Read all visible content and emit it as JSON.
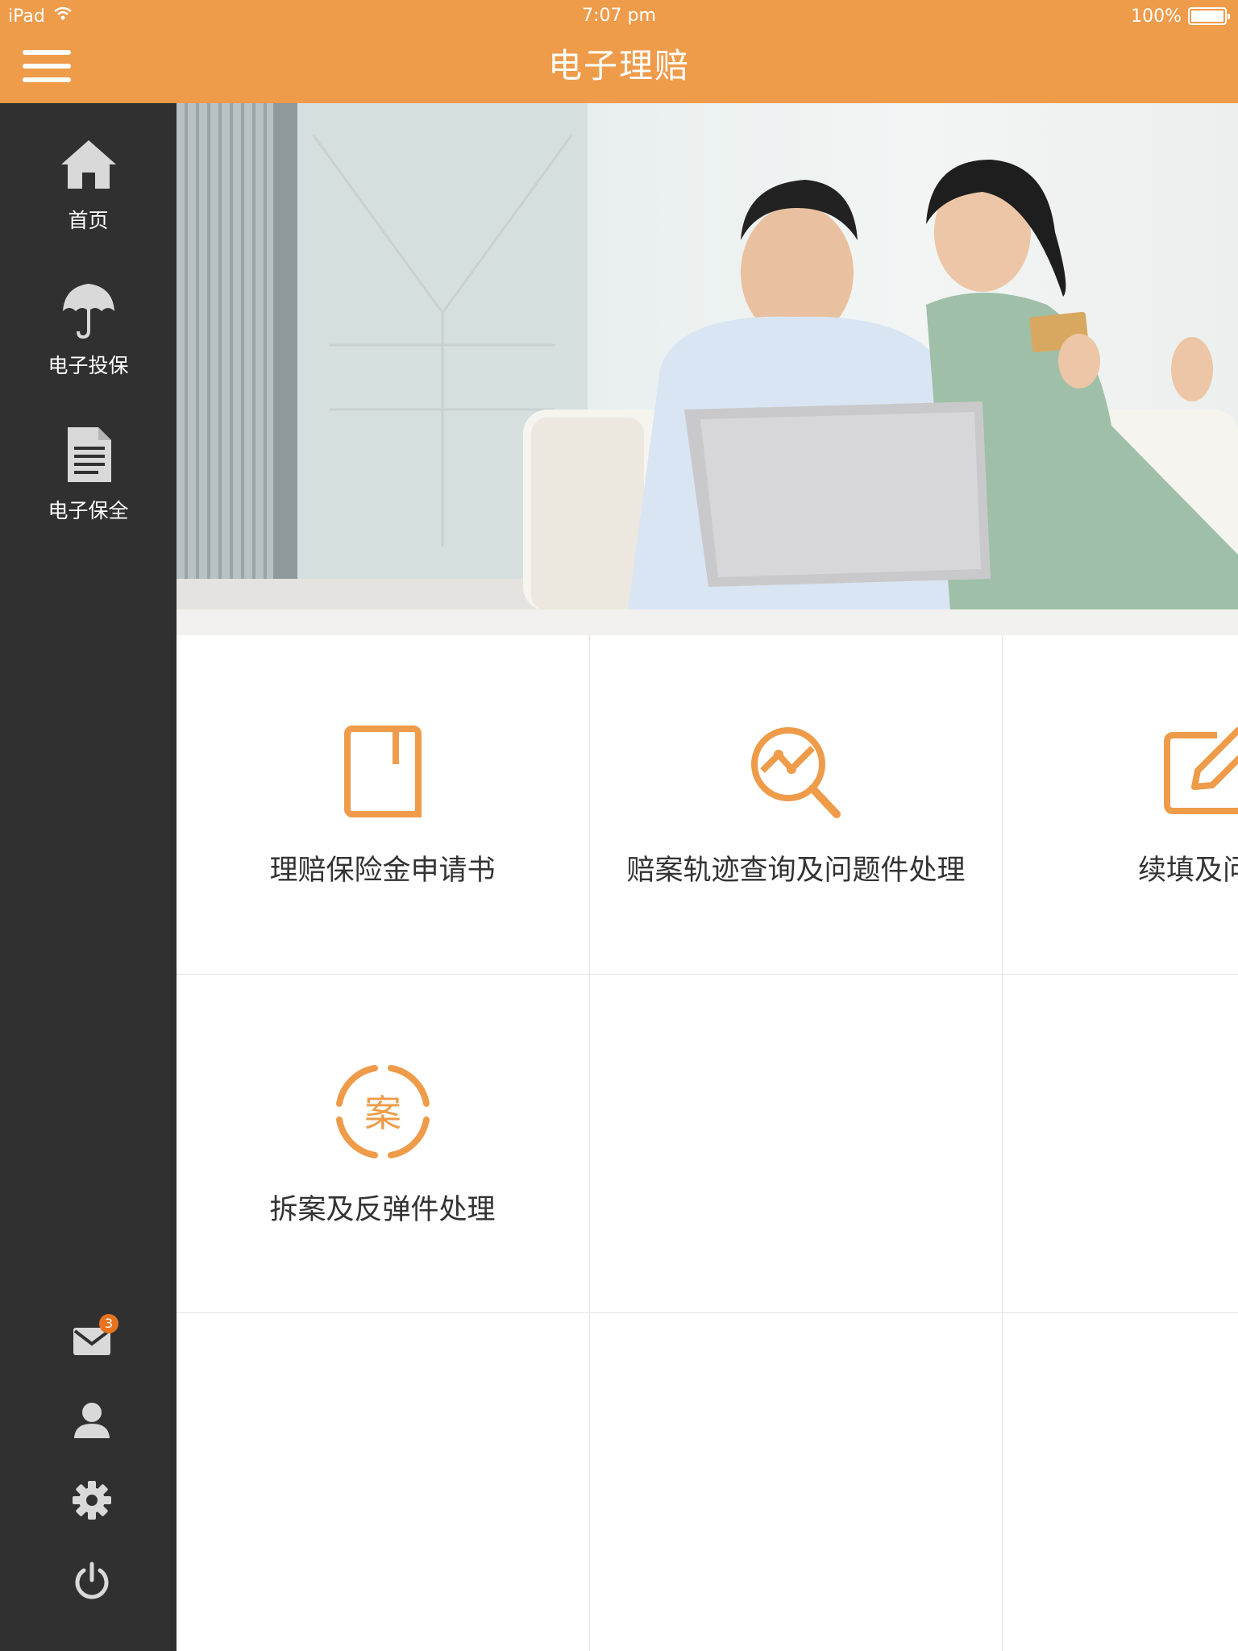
{
  "status_bar": {
    "device": "iPad",
    "time": "7:07 pm",
    "battery": "100%"
  },
  "header": {
    "title": "电子理赔"
  },
  "sidebar": {
    "items": [
      {
        "label": "首页",
        "icon": "home-icon"
      },
      {
        "label": "电子投保",
        "icon": "umbrella-icon"
      },
      {
        "label": "电子保全",
        "icon": "document-icon"
      }
    ],
    "bottom": [
      {
        "icon": "mail-icon",
        "badge": "3"
      },
      {
        "icon": "user-icon"
      },
      {
        "icon": "gear-icon"
      },
      {
        "icon": "power-icon"
      }
    ]
  },
  "colors": {
    "accent": "#ee9b4a",
    "sidebar_bg": "#303030",
    "icon_gray": "#d9d9d9",
    "badge": "#e8731e"
  },
  "tiles": [
    {
      "label": "理赔保险金申请书",
      "icon": "notebook-icon"
    },
    {
      "label": "赔案轨迹查询及问题件处理",
      "icon": "search-trend-icon"
    },
    {
      "label": "续填及问题",
      "icon": "edit-icon"
    },
    {
      "label": "拆案及反弹件处理",
      "icon": "case-stamp-icon",
      "icon_text": "案"
    }
  ]
}
